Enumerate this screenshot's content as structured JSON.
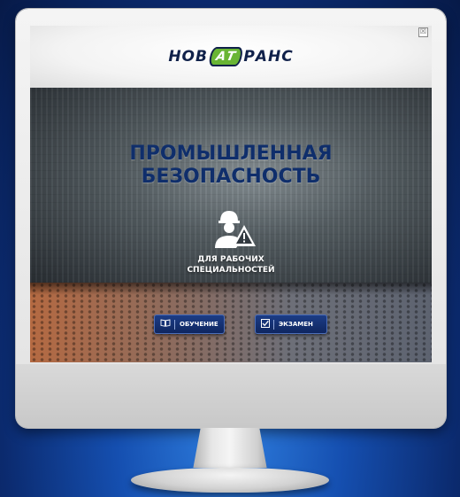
{
  "window": {
    "close_glyph": "☒"
  },
  "logo": {
    "left_text": "НОВ",
    "badge_text": "АТ",
    "right_text": "РАНС"
  },
  "main": {
    "title_line1": "ПРОМЫШЛЕННАЯ",
    "title_line2": "БЕЗОПАСНОСТЬ",
    "subtitle_line1": "ДЛЯ РАБОЧИХ",
    "subtitle_line2": "СПЕЦИАЛЬНОСТЕЙ",
    "worker_icon": "worker-warning-icon"
  },
  "buttons": {
    "learn": {
      "label": "ОБУЧЕНИЕ",
      "icon": "book-icon",
      "glyph": "📖"
    },
    "exam": {
      "label": "ЭКЗАМЕН",
      "icon": "checkbox-icon",
      "glyph": "☑"
    }
  },
  "colors": {
    "title": "#0f2e6b",
    "button_bg": "#0f2660",
    "logo_green": "#69b534"
  }
}
